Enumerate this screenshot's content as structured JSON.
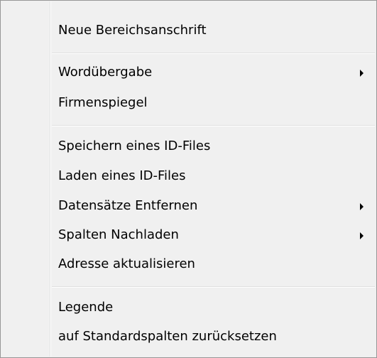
{
  "menu": {
    "items": [
      {
        "label": "Neue Bereichsanschrift"
      },
      {
        "label": "Wordübergabe",
        "submenu": true
      },
      {
        "label": "Firmenspiegel"
      },
      {
        "label": "Speichern eines ID-Files"
      },
      {
        "label": "Laden eines ID-Files"
      },
      {
        "label": "Datensätze Entfernen",
        "submenu": true
      },
      {
        "label": "Spalten Nachladen",
        "submenu": true
      },
      {
        "label": "Adresse aktualisieren"
      },
      {
        "label": "Legende"
      },
      {
        "label": "auf Standardspalten zurücksetzen"
      }
    ],
    "submenu_icon": "triangle-right-icon"
  }
}
